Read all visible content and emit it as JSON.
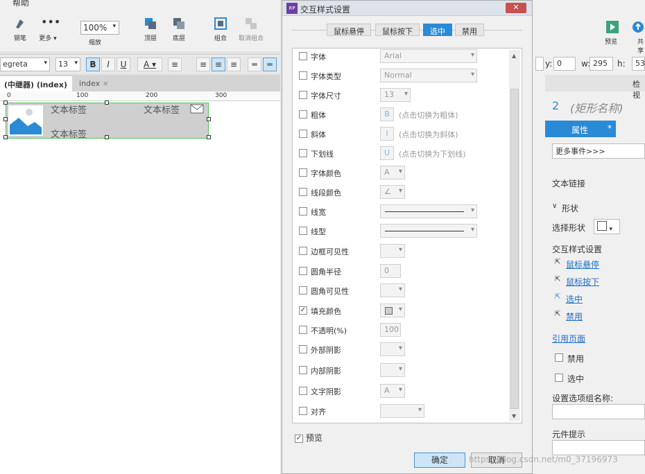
{
  "app": {
    "menu_help": "帮助"
  },
  "toolbar": {
    "pen": "钢笔",
    "more": "更多 ▾",
    "zoom_value": "100%",
    "zoom_label": "缩放",
    "top": "顶层",
    "bottom": "底层",
    "group": "组合",
    "ungroup": "取消组合",
    "preview": "预览",
    "share": "共享"
  },
  "format": {
    "font": "egreta",
    "size": "13",
    "bold": "B",
    "italic": "I",
    "underline": "U",
    "color_a": "A"
  },
  "tabs": [
    {
      "label": "(中继器) (index)",
      "close": "×"
    },
    {
      "label": "index",
      "close": "×"
    }
  ],
  "ruler": [
    "0",
    "100",
    "200",
    "300"
  ],
  "widget": {
    "lbl1": "文本标签",
    "lbl2": "文本标签",
    "lbl3": "文本标签"
  },
  "dialog": {
    "title": "交互样式设置",
    "rp": "RP",
    "close": "✕",
    "tabs": [
      "鼠标悬停",
      "鼠标按下",
      "选中",
      "禁用"
    ],
    "rows": [
      {
        "label": "字体",
        "value": "Arial",
        "checked": ""
      },
      {
        "label": "字体类型",
        "value": "Normal",
        "checked": ""
      },
      {
        "label": "字体尺寸",
        "value": "13",
        "checked": ""
      },
      {
        "label": "粗体",
        "value": "B",
        "hint": "(点击切换为粗体)",
        "checked": ""
      },
      {
        "label": "斜体",
        "value": "I",
        "hint": "(点击切换为斜体)",
        "checked": ""
      },
      {
        "label": "下划线",
        "value": "U",
        "hint": "(点击切换为下划线)",
        "checked": ""
      },
      {
        "label": "字体颜色",
        "value": "A",
        "checked": ""
      },
      {
        "label": "线段颜色",
        "value": "∠",
        "checked": ""
      },
      {
        "label": "线宽",
        "value": "",
        "checked": ""
      },
      {
        "label": "线型",
        "value": "",
        "checked": ""
      },
      {
        "label": "边框可见性",
        "value": "",
        "checked": ""
      },
      {
        "label": "圆角半径",
        "value": "0",
        "checked": ""
      },
      {
        "label": "圆角可见性",
        "value": "",
        "checked": ""
      },
      {
        "label": "填充颜色",
        "value": "",
        "checked": "✓"
      },
      {
        "label": "不透明(%)",
        "value": "100",
        "checked": ""
      },
      {
        "label": "外部阴影",
        "value": "",
        "checked": ""
      },
      {
        "label": "内部阴影",
        "value": "",
        "checked": ""
      },
      {
        "label": "文字阴影",
        "value": "A",
        "checked": ""
      },
      {
        "label": "对齐",
        "value": "",
        "checked": ""
      }
    ],
    "preview": "预览",
    "ok": "确定",
    "cancel": "取消"
  },
  "coords": {
    "y_label": "y:",
    "y": "0",
    "w_label": "w:",
    "w": "295",
    "h_label": "h:",
    "h": "53"
  },
  "right": {
    "inspect": "检视",
    "shape_num": "2",
    "shape_name": "(矩形名称)",
    "props_tab": "属性",
    "props_star": "*",
    "more_events": "更多事件>>>",
    "text_link": "文本链接",
    "shape_section": "形状",
    "select_shape": "选择形状",
    "interaction": "交互样式设置",
    "hover": "鼠标悬停",
    "press": "鼠标按下",
    "selected": "选中",
    "disabled": "禁用",
    "ref_page": "引用页面",
    "cb_disabled": "禁用",
    "cb_selected": "选中",
    "group_name": "设置选项组名称:",
    "tooltip": "元件提示"
  },
  "watermark": "https://blog.csdn.net/m0_37196973",
  "colors": {
    "accent": "#2b8ad6",
    "selection": "#55c35a"
  }
}
